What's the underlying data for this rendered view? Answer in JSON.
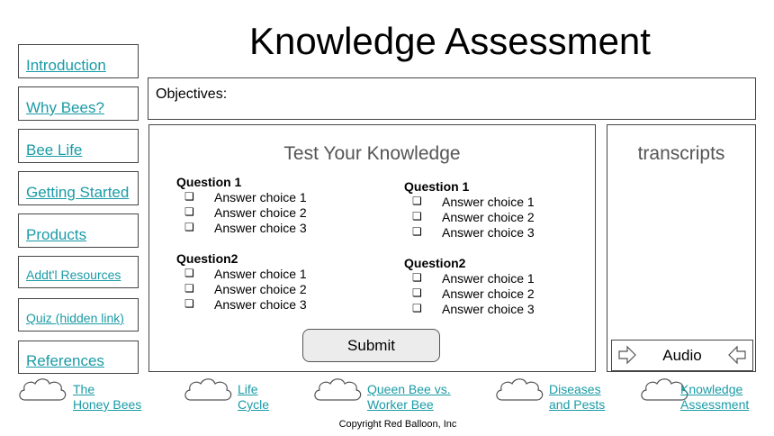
{
  "page_title": "Knowledge Assessment",
  "sidebar": {
    "items": [
      {
        "label": "Introduction"
      },
      {
        "label": "Why Bees?"
      },
      {
        "label": "Bee Life"
      },
      {
        "label": "Getting Started"
      },
      {
        "label": "Products"
      },
      {
        "label": "Addt'l Resources"
      },
      {
        "label": "Quiz (hidden link)"
      },
      {
        "label": "References"
      }
    ]
  },
  "objectives_label": "Objectives:",
  "quiz": {
    "title": "Test Your Knowledge",
    "checkbox_glyph": "❏",
    "columns": [
      {
        "questions": [
          {
            "title": "Question 1",
            "choices": [
              "Answer choice 1",
              "Answer choice 2",
              "Answer choice 3"
            ]
          },
          {
            "title": "Question2",
            "choices": [
              "Answer choice 1",
              "Answer choice 2",
              "Answer choice 3"
            ]
          }
        ]
      },
      {
        "questions": [
          {
            "title": "Question 1",
            "choices": [
              "Answer choice 1",
              "Answer choice 2",
              "Answer choice 3"
            ]
          },
          {
            "title": "Question2",
            "choices": [
              "Answer choice 1",
              "Answer choice 2",
              "Answer choice 3"
            ]
          }
        ]
      }
    ],
    "submit_label": "Submit"
  },
  "transcripts": {
    "title": "transcripts",
    "audio_label": "Audio"
  },
  "bottom_nav": [
    {
      "line1": "The",
      "line2": "Honey Bees"
    },
    {
      "line1": "Life",
      "line2": "Cycle"
    },
    {
      "line1": "Queen Bee vs.",
      "line2": "Worker Bee"
    },
    {
      "line1": "Diseases",
      "line2": "and Pests"
    },
    {
      "line1": "Knowledge",
      "line2": "Assessment"
    }
  ],
  "copyright": "Copyright Red Balloon, Inc",
  "colors": {
    "link": "#1a9ba6",
    "border": "#444444",
    "button_bg": "#ececec"
  }
}
